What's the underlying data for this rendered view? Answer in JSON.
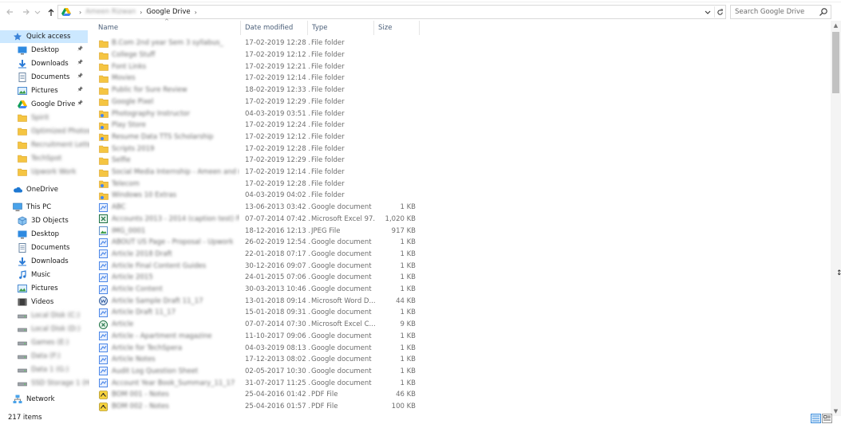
{
  "toolbar": {
    "back_icon": "arrow-left-icon",
    "forward_icon": "arrow-right-icon",
    "recent_icon": "chevron-down-icon",
    "up_icon": "arrow-up-icon",
    "breadcrumb": [
      "Ameen Rizwan",
      "Google Drive"
    ],
    "search_placeholder": "Search Google Drive"
  },
  "sidebar": {
    "items": [
      {
        "label": "Quick access",
        "icon": "star-icon",
        "pinned": false,
        "selected": true
      },
      {
        "label": "Desktop",
        "icon": "desktop-icon",
        "pinned": true
      },
      {
        "label": "Downloads",
        "icon": "download-icon",
        "pinned": true
      },
      {
        "label": "Documents",
        "icon": "documents-icon",
        "pinned": true
      },
      {
        "label": "Pictures",
        "icon": "pictures-icon",
        "pinned": true
      },
      {
        "label": "Google Drive",
        "icon": "google-drive-icon",
        "pinned": true
      },
      {
        "label": "Spirit",
        "icon": "folder-icon",
        "pinned": false,
        "blurred": true
      },
      {
        "label": "Optimized Photos",
        "icon": "folder-icon",
        "pinned": false,
        "blurred": true
      },
      {
        "label": "Recruitment Letter",
        "icon": "folder-icon",
        "pinned": false,
        "blurred": true
      },
      {
        "label": "TechSpot",
        "icon": "folder-icon",
        "pinned": false,
        "blurred": true
      },
      {
        "label": "Upwork Work",
        "icon": "folder-icon",
        "pinned": false,
        "blurred": true
      },
      {
        "label": "OneDrive",
        "icon": "cloud-icon"
      },
      {
        "label": "This PC",
        "icon": "computer-icon"
      },
      {
        "label": "3D Objects",
        "icon": "cube-icon"
      },
      {
        "label": "Desktop",
        "icon": "desktop-icon"
      },
      {
        "label": "Documents",
        "icon": "documents-icon"
      },
      {
        "label": "Downloads",
        "icon": "download-icon"
      },
      {
        "label": "Music",
        "icon": "music-icon"
      },
      {
        "label": "Pictures",
        "icon": "pictures-icon"
      },
      {
        "label": "Videos",
        "icon": "video-icon"
      },
      {
        "label": "Local Disk (C:)",
        "icon": "drive-icon",
        "blurred": true
      },
      {
        "label": "Local Disk (D:)",
        "icon": "drive-icon",
        "blurred": true
      },
      {
        "label": "Games (E:)",
        "icon": "drive-icon",
        "blurred": true
      },
      {
        "label": "Data (F:)",
        "icon": "drive-icon",
        "blurred": true
      },
      {
        "label": "Data 1 (G:)",
        "icon": "drive-icon",
        "blurred": true
      },
      {
        "label": "SSD Storage 1 (H:)",
        "icon": "drive-icon",
        "blurred": true
      },
      {
        "label": "Network",
        "icon": "network-icon"
      }
    ]
  },
  "columns": {
    "name": "Name",
    "date": "Date modified",
    "type": "Type",
    "size": "Size"
  },
  "files": [
    {
      "name": "B.Com 2nd year Sem 3 syllabus_",
      "date": "17-02-2019 12:28 ...",
      "type": "File folder",
      "size": "",
      "icon": "folder-icon"
    },
    {
      "name": "College Stuff",
      "date": "17-02-2019 12:12 ...",
      "type": "File folder",
      "size": "",
      "icon": "folder-icon"
    },
    {
      "name": "Font Links",
      "date": "17-02-2019 12:21 ...",
      "type": "File folder",
      "size": "",
      "icon": "folder-icon"
    },
    {
      "name": "Movies",
      "date": "17-02-2019 12:14 ...",
      "type": "File folder",
      "size": "",
      "icon": "folder-icon"
    },
    {
      "name": "Public for Sure Review",
      "date": "18-02-2019 12:33 ...",
      "type": "File folder",
      "size": "",
      "icon": "folder-icon"
    },
    {
      "name": "Google Pixel",
      "date": "17-02-2019 12:29 ...",
      "type": "File folder",
      "size": "",
      "icon": "folder-icon"
    },
    {
      "name": "Photography Instructor",
      "date": "04-03-2019 03:51 ...",
      "type": "File folder",
      "size": "",
      "icon": "folder-shared-icon"
    },
    {
      "name": "Play Store",
      "date": "17-02-2019 12:24 ...",
      "type": "File folder",
      "size": "",
      "icon": "folder-shared-icon"
    },
    {
      "name": "Resume Data TTS Scholarship",
      "date": "17-02-2019 12:12 ...",
      "type": "File folder",
      "size": "",
      "icon": "folder-shared-icon"
    },
    {
      "name": "Scripts 2019",
      "date": "17-02-2019 12:28 ...",
      "type": "File folder",
      "size": "",
      "icon": "folder-icon"
    },
    {
      "name": "Selfie",
      "date": "17-02-2019 12:29 ...",
      "type": "File folder",
      "size": "",
      "icon": "folder-icon"
    },
    {
      "name": "Social Media Internship - Ameen and more",
      "date": "17-02-2019 12:14 ...",
      "type": "File folder",
      "size": "",
      "icon": "folder-icon"
    },
    {
      "name": "Telecom",
      "date": "17-02-2019 12:28 ...",
      "type": "File folder",
      "size": "",
      "icon": "folder-shared-icon"
    },
    {
      "name": "Windows 10 Extras",
      "date": "04-03-2019 04:02 ...",
      "type": "File folder",
      "size": "",
      "icon": "folder-shared-icon"
    },
    {
      "name": "ABC",
      "date": "13-06-2013 03:42 ...",
      "type": "Google document",
      "size": "1 KB",
      "icon": "google-doc-icon"
    },
    {
      "name": "Accounts 2013 - 2014 (caption test) Files_Doc",
      "date": "07-07-2014 07:42 ...",
      "type": "Microsoft Excel 97...",
      "size": "1,020 KB",
      "icon": "excel-icon"
    },
    {
      "name": "IMG_0001",
      "date": "18-12-2016 12:13 ...",
      "type": "JPEG File",
      "size": "917 KB",
      "icon": "image-icon"
    },
    {
      "name": "ABOUT US Page - Proposal - Upwork",
      "date": "26-02-2019 12:54 ...",
      "type": "Google document",
      "size": "1 KB",
      "icon": "google-doc-icon"
    },
    {
      "name": "Article 2018 Draft",
      "date": "22-01-2018 07:17 ...",
      "type": "Google document",
      "size": "1 KB",
      "icon": "google-doc-icon"
    },
    {
      "name": "Article Final Content Guides",
      "date": "30-12-2016 09:07 ...",
      "type": "Google document",
      "size": "1 KB",
      "icon": "google-doc-icon"
    },
    {
      "name": "Article 2015",
      "date": "24-01-2015 07:06 ...",
      "type": "Google document",
      "size": "1 KB",
      "icon": "google-doc-icon"
    },
    {
      "name": "Article Content",
      "date": "30-03-2013 10:46 ...",
      "type": "Google document",
      "size": "1 KB",
      "icon": "google-doc-icon"
    },
    {
      "name": "Article Sample Draft 11_17",
      "date": "13-01-2018 09:14 ...",
      "type": "Microsoft Word D...",
      "size": "44 KB",
      "icon": "word-icon"
    },
    {
      "name": "Article Draft 11_17",
      "date": "15-01-2018 09:31 ...",
      "type": "Google document",
      "size": "1 KB",
      "icon": "google-doc-icon"
    },
    {
      "name": "Article",
      "date": "07-07-2014 07:30 ...",
      "type": "Microsoft Excel C...",
      "size": "9 KB",
      "icon": "excel-csv-icon"
    },
    {
      "name": "Article - Apartment magazine",
      "date": "11-10-2017 09:06 ...",
      "type": "Google document",
      "size": "1 KB",
      "icon": "google-doc-icon"
    },
    {
      "name": "Article for TechSpera",
      "date": "04-03-2019 08:13 ...",
      "type": "Google document",
      "size": "1 KB",
      "icon": "google-doc-icon"
    },
    {
      "name": "Article Notes",
      "date": "17-12-2013 08:02 ...",
      "type": "Google document",
      "size": "1 KB",
      "icon": "google-doc-icon"
    },
    {
      "name": "Audit Log Question Sheet",
      "date": "02-05-2017 10:30 ...",
      "type": "Google document",
      "size": "1 KB",
      "icon": "google-doc-icon"
    },
    {
      "name": "Account Year Book_Summary_11_17",
      "date": "31-07-2017 11:25 ...",
      "type": "Google document",
      "size": "1 KB",
      "icon": "google-doc-icon"
    },
    {
      "name": "BOM 001 - Notes",
      "date": "25-04-2016 01:42 ...",
      "type": "PDF File",
      "size": "46 KB",
      "icon": "pdf-icon"
    },
    {
      "name": "BOM 002 - Notes",
      "date": "25-04-2016 01:57 ...",
      "type": "PDF File",
      "size": "100 KB",
      "icon": "pdf-icon"
    }
  ],
  "status": {
    "item_count": "217 items"
  },
  "colors": {
    "selection": "#cce8ff",
    "folder": "#f5c542",
    "doc_blue": "#4a86e8",
    "header_text": "#4c607a"
  }
}
